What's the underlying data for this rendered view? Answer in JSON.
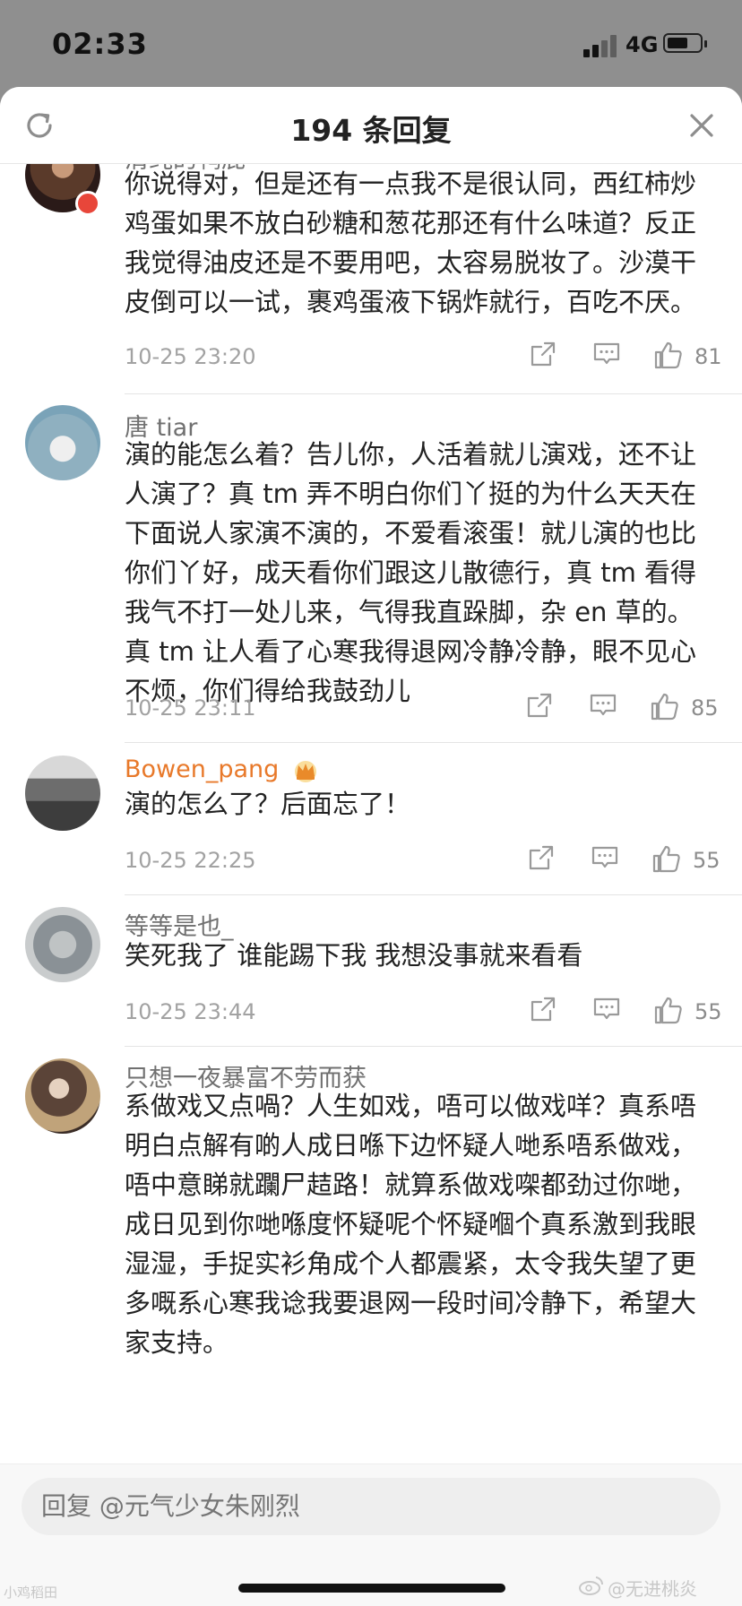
{
  "status_bar": {
    "time": "02:33",
    "network": "4G"
  },
  "header": {
    "title": "194 条回复"
  },
  "comments": [
    {
      "username": "清纯的鸭屁",
      "text": "你说得对，但是还有一点我不是很认同，西红柿炒鸡蛋如果不放白砂糖和葱花那还有什么味道？反正我觉得油皮还是不要用吧，太容易脱妆了。沙漠干皮倒可以一试，裹鸡蛋液下锅炸就行，百吃不厌。",
      "date": "10-25 23:20",
      "likes": "81"
    },
    {
      "username": "唐 tiar",
      "text": "演的能怎么着？告儿你，人活着就儿演戏，还不让人演了？真 tm 弄不明白你们丫挺的为什么天天在下面说人家演不演的，不爱看滚蛋！就儿演的也比你们丫好，成天看你们跟这儿散德行，真 tm 看得我气不打一处儿来，气得我直跺脚，杂 en 草的。真 tm 让人看了心寒我得退网冷静冷静，眼不见心不烦，你们得给我鼓劲儿",
      "date": "10-25 23:11",
      "likes": "85"
    },
    {
      "username": "Bowen_pang",
      "text": "演的怎么了？后面忘了！",
      "date": "10-25 22:25",
      "likes": "55"
    },
    {
      "username": "等等是也_",
      "text": "笑死我了 谁能踢下我 我想没事就来看看",
      "date": "10-25 23:44",
      "likes": "55"
    },
    {
      "username": "只想一夜暴富不劳而获",
      "text": "系做戏又点喎？人生如戏，唔可以做戏咩？真系唔明白点解有啲人成日喺下边怀疑人哋系唔系做戏，唔中意睇就躝尸趌路！就算系做戏㗎都劲过你哋，成日见到你哋喺度怀疑呢个怀疑嗰个真系激到我眼湿湿，手捉实衫角成个人都震紧，太令我失望了更多嘅系心寒我谂我要退网一段时间冷静下，希望大家支持。"
    }
  ],
  "reply_box": {
    "placeholder": "回复 @元气少女朱刚烈"
  },
  "watermark": {
    "left": "小鸡稻田",
    "right": "@无进桃炎"
  }
}
